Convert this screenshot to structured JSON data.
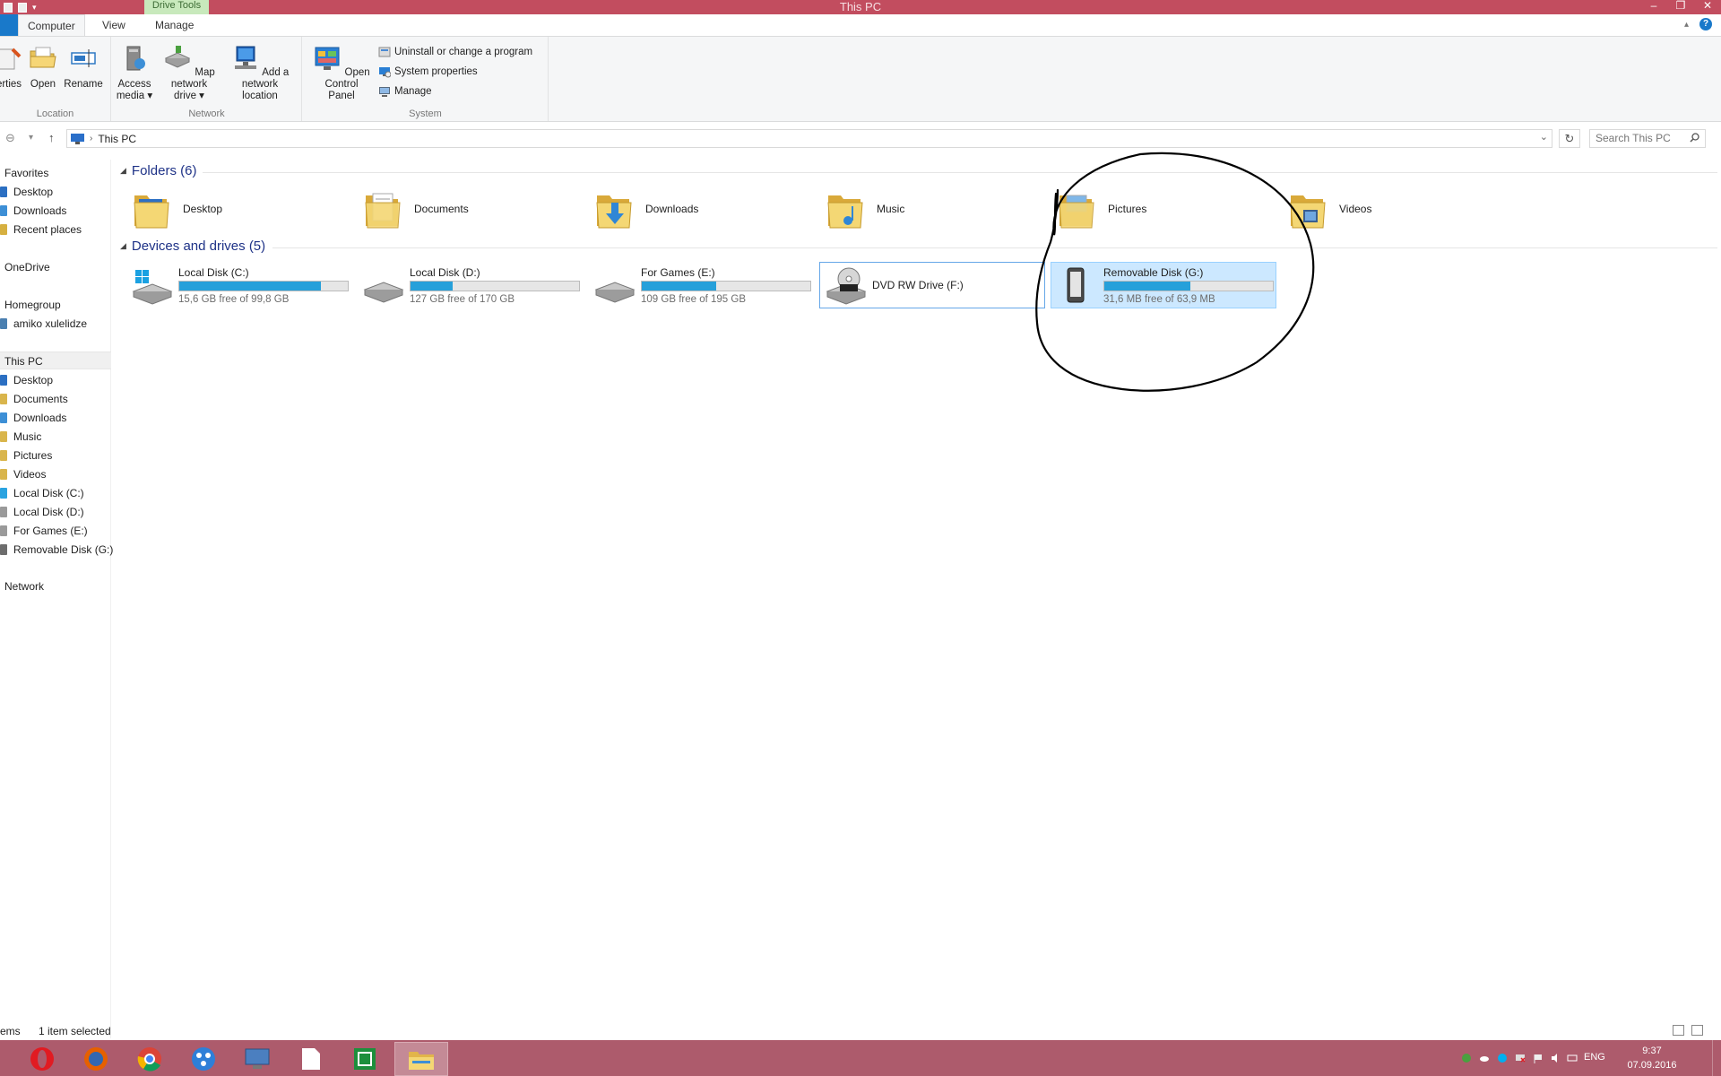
{
  "window": {
    "title": "This PC",
    "context_tab": "Drive Tools",
    "controls": [
      "–",
      "❐",
      "✕"
    ]
  },
  "ribbon_tabs": [
    {
      "label": "Computer",
      "active": true
    },
    {
      "label": "View",
      "active": false
    },
    {
      "label": "Manage",
      "active": false
    }
  ],
  "ribbon": {
    "location": {
      "label": "Location",
      "buttons": [
        "erties",
        "Open",
        "Rename"
      ]
    },
    "network": {
      "label": "Network",
      "buttons": [
        {
          "line1": "Access",
          "line2": "media ▾"
        },
        {
          "line1": "Map network",
          "line2": "drive ▾"
        },
        {
          "line1": "Add a network",
          "line2": "location"
        }
      ]
    },
    "system": {
      "label": "System",
      "open_control_panel": {
        "line1": "Open Control",
        "line2": "Panel"
      },
      "small_buttons": [
        "Uninstall or change a program",
        "System properties",
        "Manage"
      ]
    },
    "help": "?"
  },
  "address_bar": {
    "crumb": "This PC",
    "search_placeholder": "Search This PC"
  },
  "nav_pane": {
    "favorites": {
      "label": "Favorites",
      "items": [
        "Desktop",
        "Downloads",
        "Recent places"
      ]
    },
    "onedrive": "OneDrive",
    "homegroup": {
      "label": "Homegroup",
      "items": [
        "amiko xulelidze"
      ]
    },
    "this_pc": {
      "label": "This PC",
      "items": [
        "Desktop",
        "Documents",
        "Downloads",
        "Music",
        "Pictures",
        "Videos",
        "Local Disk (C:)",
        "Local Disk (D:)",
        "For Games (E:)",
        "Removable Disk (G:)"
      ]
    },
    "network": "Network"
  },
  "content": {
    "folders_header": "Folders (6)",
    "folders": [
      "Desktop",
      "Documents",
      "Downloads",
      "Music",
      "Pictures",
      "Videos"
    ],
    "drives_header": "Devices and drives (5)",
    "drives": [
      {
        "name": "Local Disk (C:)",
        "free": "15,6 GB free of 99,8 GB",
        "used_fraction": 0.84
      },
      {
        "name": "Local Disk (D:)",
        "free": "127 GB free of 170 GB",
        "used_fraction": 0.25
      },
      {
        "name": "For Games (E:)",
        "free": "109 GB free of 195 GB",
        "used_fraction": 0.44
      },
      {
        "name": "DVD RW Drive (F:)"
      },
      {
        "name": "Removable Disk (G:)",
        "free": "31,6 MB free of 63,9 MB",
        "used_fraction": 0.51
      }
    ]
  },
  "status_bar": {
    "items_text": "ems",
    "selected_text": "1 item selected"
  },
  "taskbar": {
    "apps": [
      "opera-icon",
      "firefox-icon",
      "chrome-icon",
      "network-app-icon",
      "remote-desktop-icon",
      "file-icon",
      "excel-icon",
      "file-explorer-icon"
    ],
    "lang": "ENG",
    "time": "9:37",
    "date": "07.09.2016"
  },
  "colors": {
    "titlebar": "#c24d5f",
    "taskbar": "#ad5b6c",
    "accent": "#1979ca",
    "bar_fill": "#26a0da",
    "selection": "#cce8ff",
    "section_header": "#1e3287"
  }
}
